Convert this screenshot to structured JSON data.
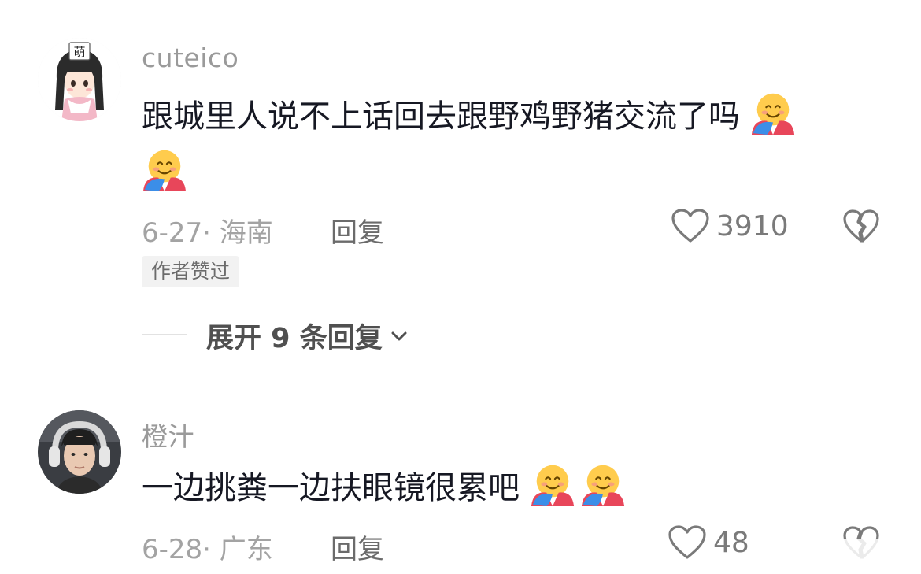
{
  "comments": [
    {
      "username": "cuteico",
      "text": "跟城里人说不上话回去跟野鸡野猪交流了吗",
      "emoji": "hugging-face-emoji",
      "date_location": "6-27· 海南",
      "reply_label": "回复",
      "likes": "3910",
      "author_badge": "作者赞过",
      "expand_label": "展开 9 条回复"
    },
    {
      "username": "橙汁",
      "text": "一边挑粪一边扶眼镜很累吧",
      "emoji": "hugging-face-emoji",
      "date_location": "6-28· 广东",
      "reply_label": "回复",
      "likes": "48"
    }
  ],
  "colors": {
    "text": "#161823",
    "muted": "#a3a3a3",
    "badge_bg": "#f2f2f2"
  }
}
